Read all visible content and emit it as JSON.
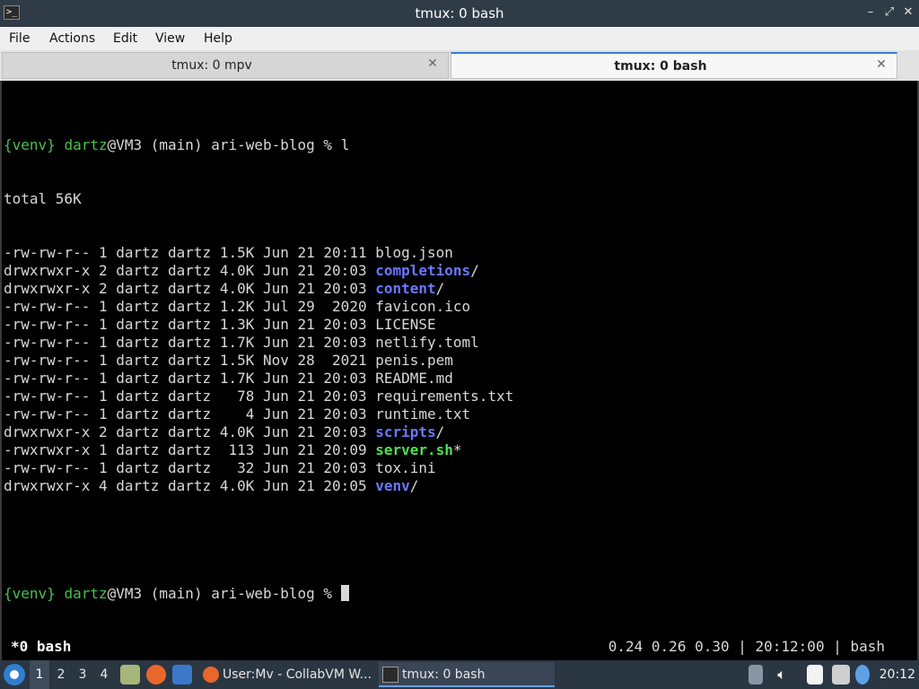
{
  "window": {
    "title": "tmux: 0 bash",
    "app_icon": "terminal-icon",
    "app_icon_glyph": ">_",
    "controls": {
      "minimize": "–",
      "restore": "⤢",
      "close": "✕"
    }
  },
  "menu": {
    "items": [
      "File",
      "Actions",
      "Edit",
      "View",
      "Help"
    ]
  },
  "tabs": [
    {
      "label": "tmux: 0 mpv",
      "active": false,
      "close": "✕"
    },
    {
      "label": "tmux: 0 bash",
      "active": true,
      "close": "✕"
    }
  ],
  "terminal": {
    "prompt": {
      "env": "{venv}",
      "user": "dartz",
      "rest": "@VM3 (main) ari-web-blog % "
    },
    "command": "l",
    "total": "total 56K",
    "entries": [
      {
        "meta": "-rw-rw-r-- 1 dartz dartz 1.5K Jun 21 20:11 ",
        "name": "blog.json",
        "kind": "file",
        "suffix": ""
      },
      {
        "meta": "drwxrwxr-x 2 dartz dartz 4.0K Jun 21 20:03 ",
        "name": "completions",
        "kind": "dir",
        "suffix": "/"
      },
      {
        "meta": "drwxrwxr-x 2 dartz dartz 4.0K Jun 21 20:03 ",
        "name": "content",
        "kind": "dir",
        "suffix": "/"
      },
      {
        "meta": "-rw-rw-r-- 1 dartz dartz 1.2K Jul 29  2020 ",
        "name": "favicon.ico",
        "kind": "file",
        "suffix": ""
      },
      {
        "meta": "-rw-rw-r-- 1 dartz dartz 1.3K Jun 21 20:03 ",
        "name": "LICENSE",
        "kind": "file",
        "suffix": ""
      },
      {
        "meta": "-rw-rw-r-- 1 dartz dartz 1.7K Jun 21 20:03 ",
        "name": "netlify.toml",
        "kind": "file",
        "suffix": ""
      },
      {
        "meta": "-rw-rw-r-- 1 dartz dartz 1.5K Nov 28  2021 ",
        "name": "penis.pem",
        "kind": "file",
        "suffix": ""
      },
      {
        "meta": "-rw-rw-r-- 1 dartz dartz 1.7K Jun 21 20:03 ",
        "name": "README.md",
        "kind": "file",
        "suffix": ""
      },
      {
        "meta": "-rw-rw-r-- 1 dartz dartz   78 Jun 21 20:03 ",
        "name": "requirements.txt",
        "kind": "file",
        "suffix": ""
      },
      {
        "meta": "-rw-rw-r-- 1 dartz dartz    4 Jun 21 20:03 ",
        "name": "runtime.txt",
        "kind": "file",
        "suffix": ""
      },
      {
        "meta": "drwxrwxr-x 2 dartz dartz 4.0K Jun 21 20:03 ",
        "name": "scripts",
        "kind": "dir",
        "suffix": "/"
      },
      {
        "meta": "-rwxrwxr-x 1 dartz dartz  113 Jun 21 20:09 ",
        "name": "server.sh",
        "kind": "exe",
        "suffix": "*"
      },
      {
        "meta": "-rw-rw-r-- 1 dartz dartz   32 Jun 21 20:03 ",
        "name": "tox.ini",
        "kind": "file",
        "suffix": ""
      },
      {
        "meta": "drwxrwxr-x 4 dartz dartz 4.0K Jun 21 20:05 ",
        "name": "venv",
        "kind": "dir",
        "suffix": "/"
      }
    ],
    "colors": {
      "prompt_green": "#47c24e",
      "dir_blue": "#6a78ff",
      "exe_green": "#4ce04f",
      "text": "#d8d8d8"
    }
  },
  "tmux_status": {
    "window": "*0 bash",
    "right": "0.24 0.26 0.30 | 20:12:00 | bash"
  },
  "taskbar": {
    "start_icon": "lxqt-start-icon",
    "workspaces": [
      "1",
      "2",
      "3",
      "4"
    ],
    "active_workspace": "1",
    "launchers": [
      "file-manager-icon",
      "firefox-icon",
      "desktop-icon"
    ],
    "tasks": [
      {
        "label": "User:Mv - CollabVM W...",
        "icon": "firefox-icon",
        "active": false
      },
      {
        "label": "tmux: 0 bash",
        "icon": "terminal-icon",
        "active": true
      }
    ],
    "tray": [
      "upload-icon",
      "volume-icon",
      "clipboard-icon",
      "network-icon",
      "update-icon"
    ],
    "clock": "20:12"
  }
}
